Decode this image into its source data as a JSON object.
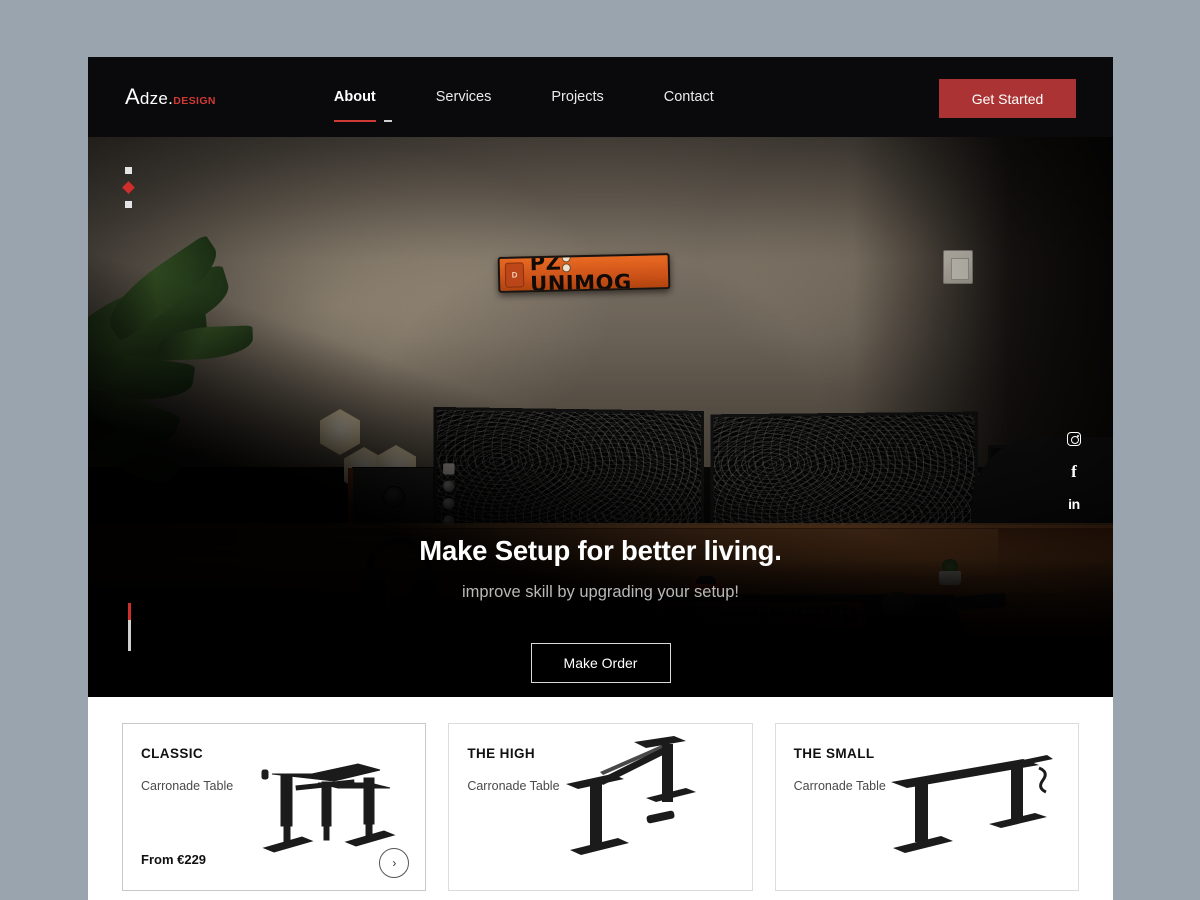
{
  "theme": {
    "page_bg": "#9aa4ae",
    "nav_bg": "#0a0a0c",
    "accent_red": "#cf2f2a",
    "cta_bg": "#ab3333",
    "card_border": "#dcdcdc"
  },
  "nav": {
    "logo": {
      "part_a": "A",
      "part_b": "dze.",
      "part_c": "DESIGN"
    },
    "links": [
      {
        "label": "About",
        "active": true
      },
      {
        "label": "Services",
        "active": false
      },
      {
        "label": "Projects",
        "active": false
      },
      {
        "label": "Contact",
        "active": false
      }
    ],
    "cta_label": "Get Started"
  },
  "hero": {
    "slider_dots": [
      "square",
      "diamond-active",
      "square"
    ],
    "license_plate": {
      "text": "PZ UNIMOG",
      "badge": "D"
    },
    "headline": "Make Setup for better living.",
    "subheadline": "improve skill by upgrading your setup!",
    "button_label": "Make Order",
    "socials": [
      {
        "name": "instagram-icon",
        "glyph": ""
      },
      {
        "name": "facebook-icon",
        "glyph": "f"
      },
      {
        "name": "linkedin-icon",
        "glyph": "in"
      }
    ],
    "progress": {
      "value_pct": 35
    }
  },
  "products": [
    {
      "title": "CLASSIC",
      "subtitle": "Carronade Table",
      "price": "From €229",
      "has_arrow": true,
      "arrow_glyph": "›",
      "image": "desk-frame-corner"
    },
    {
      "title": "THE HIGH",
      "subtitle": "Carronade Table",
      "price": "",
      "has_arrow": false,
      "arrow_glyph": "",
      "image": "desk-frame-high"
    },
    {
      "title": "THE SMALL",
      "subtitle": "Carronade Table",
      "price": "",
      "has_arrow": false,
      "arrow_glyph": "",
      "image": "desk-frame-small"
    }
  ]
}
